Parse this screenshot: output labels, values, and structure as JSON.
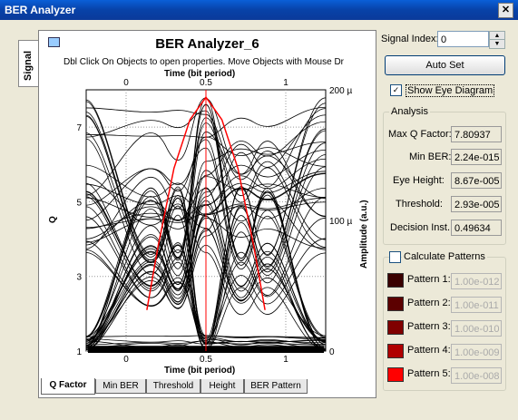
{
  "window": {
    "title": "BER Analyzer"
  },
  "side_tab": {
    "label": "Signal"
  },
  "plot": {
    "title": "BER Analyzer_6",
    "subtitle": "Dbl Click On Objects to open properties.  Move Objects with Mouse Dr",
    "x_axis_top": "Time (bit period)",
    "x_axis_bottom": "Time (bit period)",
    "y_axis_left": "Q",
    "y_axis_right": "Amplitude (a.u.)",
    "x_ticks": [
      "0",
      "0.5",
      "1"
    ],
    "q_ticks": [
      "1",
      "3",
      "5",
      "7"
    ],
    "amp_ticks": [
      "0",
      "100 µ",
      "200 µ"
    ]
  },
  "chart_data": {
    "type": "line",
    "title": "BER Analyzer_6",
    "xlabel": "Time (bit period)",
    "ylabel_left": "Q",
    "ylabel_right": "Amplitude (a.u.)",
    "xlim": [
      -0.25,
      1.25
    ],
    "ylim_left": [
      1,
      8
    ],
    "ylim_right": [
      0,
      200
    ],
    "series": [
      {
        "name": "Q Factor",
        "color": "#ff0000",
        "x": [
          0.13,
          0.2,
          0.3,
          0.4,
          0.5,
          0.6,
          0.7,
          0.8,
          0.87
        ],
        "y": [
          2.1,
          3.8,
          5.9,
          7.2,
          7.8,
          7.2,
          5.9,
          3.8,
          2.1
        ]
      }
    ]
  },
  "bottom_tabs": [
    "Q Factor",
    "Min BER",
    "Threshold",
    "Height",
    "BER Pattern"
  ],
  "controls": {
    "signal_index_label": "Signal Index:",
    "signal_index_value": "0",
    "auto_set": "Auto Set",
    "show_eye_label": "Show Eye Diagram",
    "show_eye_checked": "✓"
  },
  "analysis": {
    "title": "Analysis",
    "rows": [
      {
        "label": "Max Q Factor:",
        "value": "7.80937"
      },
      {
        "label": "Min BER:",
        "value": "2.24e-015"
      },
      {
        "label": "Eye Height:",
        "value": "8.67e-005"
      },
      {
        "label": "Threshold:",
        "value": "2.93e-005"
      },
      {
        "label": "Decision Inst.:",
        "value": "0.49634"
      }
    ]
  },
  "patterns": {
    "title": "Calculate Patterns",
    "rows": [
      {
        "label": "Pattern 1:",
        "value": "1.00e-012",
        "color": "#3a0000"
      },
      {
        "label": "Pattern 2:",
        "value": "1.00e-011",
        "color": "#5c0000"
      },
      {
        "label": "Pattern 3:",
        "value": "1.00e-010",
        "color": "#800000"
      },
      {
        "label": "Pattern 4:",
        "value": "1.00e-009",
        "color": "#b00000"
      },
      {
        "label": "Pattern 5:",
        "value": "1.00e-008",
        "color": "#ff0000"
      }
    ]
  }
}
